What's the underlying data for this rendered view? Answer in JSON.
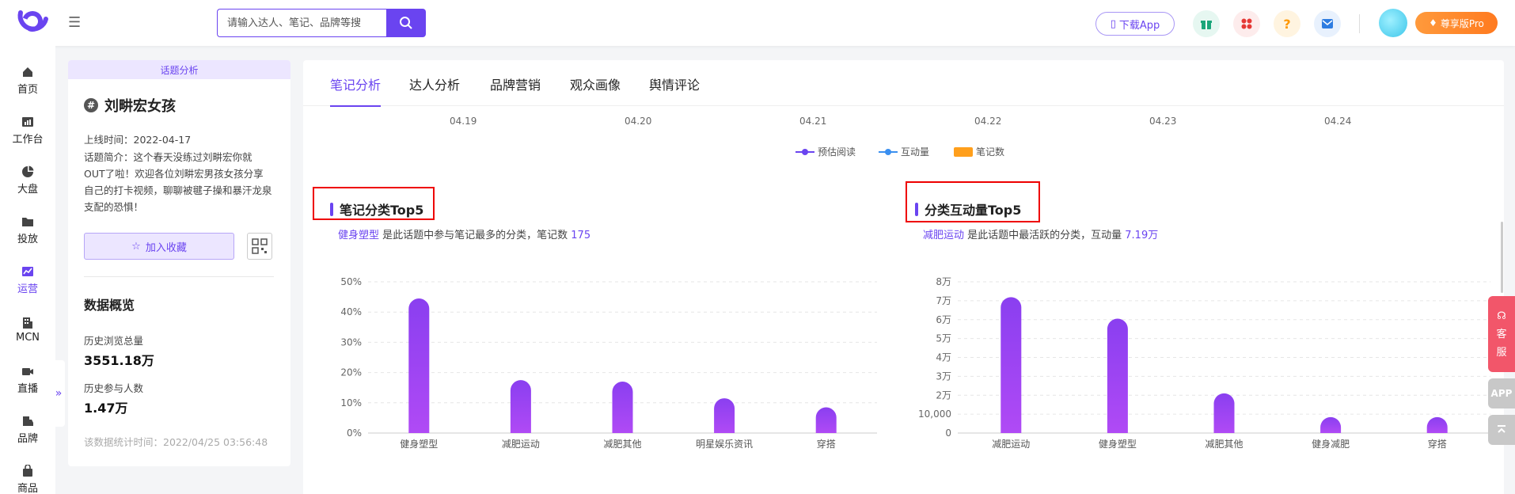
{
  "header": {
    "search_placeholder": "请输入达人、笔记、品牌等搜",
    "download_label": "下载App",
    "pro_label": "尊享版Pro"
  },
  "nav": {
    "items": [
      {
        "label": "首页",
        "icon": "home-icon"
      },
      {
        "label": "工作台",
        "icon": "dashboard-icon"
      },
      {
        "label": "大盘",
        "icon": "pie-icon"
      },
      {
        "label": "投放",
        "icon": "folder-icon"
      },
      {
        "label": "运营",
        "icon": "trend-icon",
        "active": true
      },
      {
        "label": "MCN",
        "icon": "building-icon"
      },
      {
        "label": "直播",
        "icon": "video-icon"
      },
      {
        "label": "品牌",
        "icon": "brand-icon"
      },
      {
        "label": "商品",
        "icon": "bag-icon"
      }
    ],
    "expand": "»"
  },
  "topic": {
    "tag": "话题分析",
    "title": "刘畊宏女孩",
    "online_time": "上线时间：2022-04-17",
    "intro_lines": [
      "话题简介：这个春天没练过刘畊宏你就",
      "OUT了啦！欢迎各位刘畊宏男孩女孩分享",
      "自己的打卡视频，聊聊被毽子操和暴汗龙泉",
      "支配的恐惧！"
    ],
    "fav_label": "加入收藏",
    "overview_title": "数据概览",
    "views_label": "历史浏览总量",
    "views_value": "3551.18万",
    "participants_label": "历史参与人数",
    "participants_value": "1.47万",
    "stat_time": "该数据统计时间：2022/04/25 03:56:48"
  },
  "tabs": [
    "笔记分析",
    "达人分析",
    "品牌营销",
    "观众画像",
    "舆情评论"
  ],
  "trend": {
    "dates": [
      "04.19",
      "04.20",
      "04.21",
      "04.22",
      "04.23",
      "04.24"
    ],
    "legend": [
      {
        "label": "预估阅读",
        "color": "#6a44f0"
      },
      {
        "label": "互动量",
        "color": "#3a8ff0"
      },
      {
        "label": "笔记数",
        "color": "#ff9f1c"
      }
    ]
  },
  "chart_left": {
    "title": "笔记分类Top5",
    "sub_highlight": "健身塑型",
    "sub_text": " 是此话题中参与笔记最多的分类，笔记数 ",
    "sub_value": "175"
  },
  "chart_right": {
    "title": "分类互动量Top5",
    "sub_highlight": "减肥运动",
    "sub_text": " 是此话题中最活跃的分类，互动量 ",
    "sub_value": "7.19万"
  },
  "chart_data": [
    {
      "type": "bar",
      "title": "笔记分类Top5",
      "categories": [
        "健身塑型",
        "减肥运动",
        "减肥其他",
        "明星娱乐资讯",
        "穿搭"
      ],
      "values": [
        44.5,
        17.5,
        17,
        11.5,
        8.5
      ],
      "yticks": [
        "0%",
        "10%",
        "20%",
        "30%",
        "40%",
        "50%"
      ],
      "ylim": [
        0,
        50
      ]
    },
    {
      "type": "bar",
      "title": "分类互动量Top5",
      "categories": [
        "减肥运动",
        "健身塑型",
        "减肥其他",
        "健身减肥",
        "穿搭"
      ],
      "values": [
        71900,
        60500,
        21000,
        6000,
        6000
      ],
      "yticks": [
        "0",
        "10,000",
        "2万",
        "3万",
        "4万",
        "5万",
        "6万",
        "7万",
        "8万"
      ],
      "ylim": [
        0,
        80000
      ]
    }
  ],
  "side": {
    "kefu1": "客",
    "kefu2": "服",
    "app": "APP"
  }
}
